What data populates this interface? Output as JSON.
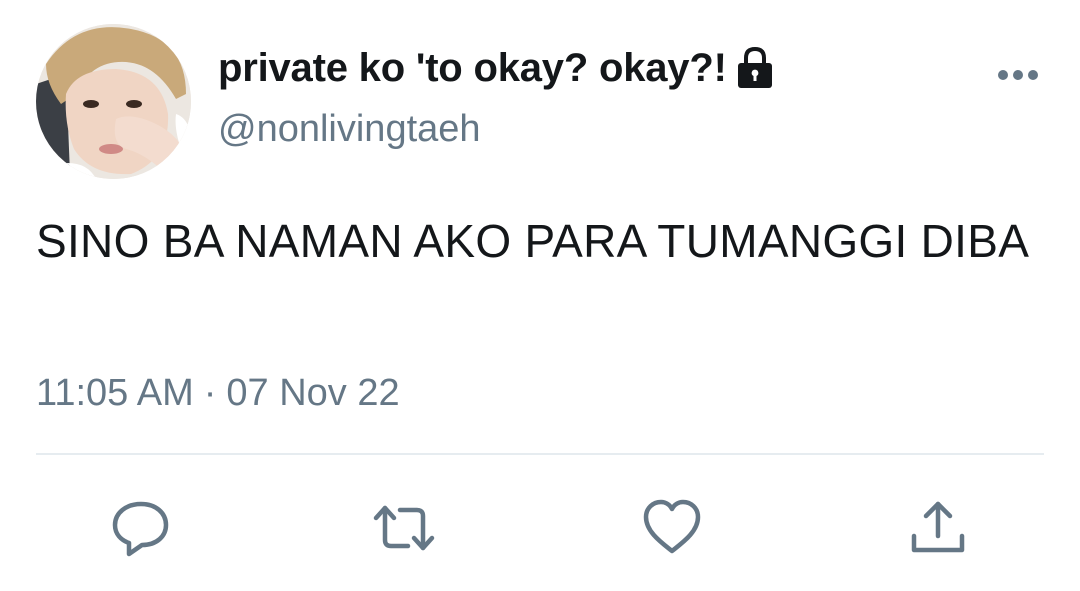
{
  "author": {
    "display_name": "private ko 'to okay? okay?!",
    "handle": "@nonlivingtaeh",
    "protected_icon": "lock-icon"
  },
  "tweet": {
    "text": "SINO BA NAMAN AKO PARA TUMANGGI DIBA",
    "time": "11:05 AM",
    "separator": "·",
    "date": "07 Nov 22"
  },
  "actions": {
    "reply_icon": "speech-bubble-icon",
    "retweet_icon": "retweet-arrows-icon",
    "like_icon": "heart-icon",
    "share_icon": "share-upload-icon"
  },
  "colors": {
    "text_primary": "#14171a",
    "text_secondary": "#657786",
    "divider": "#e6ecf0"
  }
}
